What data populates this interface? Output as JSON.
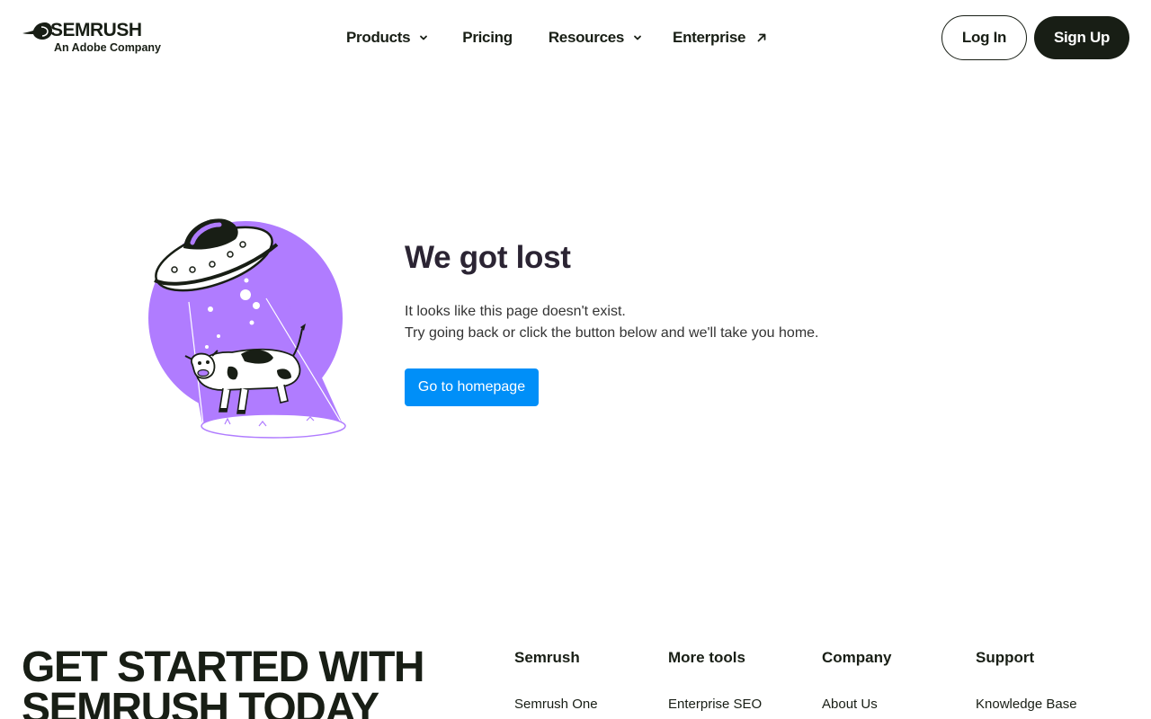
{
  "header": {
    "logo": {
      "name": "SEMRUSH",
      "tagline": "An Adobe Company",
      "icon": "semrush-logo-mark"
    },
    "nav": [
      {
        "label": "Products",
        "icon": "chevron-down-icon"
      },
      {
        "label": "Pricing"
      },
      {
        "label": "Resources",
        "icon": "chevron-down-icon"
      },
      {
        "label": "Enterprise",
        "icon": "external-arrow-icon"
      }
    ],
    "login_label": "Log In",
    "signup_label": "Sign Up"
  },
  "main": {
    "illustration": "ufo-abducting-cow-illustration",
    "title": "We got lost",
    "description_line1": "It looks like this page doesn't exist.",
    "description_line2": "Try going back or click the button below and we'll take you home.",
    "button_label": "Go to homepage"
  },
  "footer": {
    "cta_line1": "GET STARTED WITH",
    "cta_line2": "SEMRUSH TODAY",
    "columns": [
      {
        "title": "Semrush",
        "first_link": "Semrush One"
      },
      {
        "title": "More tools",
        "first_link": "Enterprise SEO"
      },
      {
        "title": "Company",
        "first_link": "About Us"
      },
      {
        "title": "Support",
        "first_link": "Knowledge Base"
      }
    ]
  },
  "colors": {
    "brand_dark": "#181e15",
    "primary_button": "#008ff8",
    "illustration_purple": "#b07cff",
    "text_body": "#333333"
  }
}
